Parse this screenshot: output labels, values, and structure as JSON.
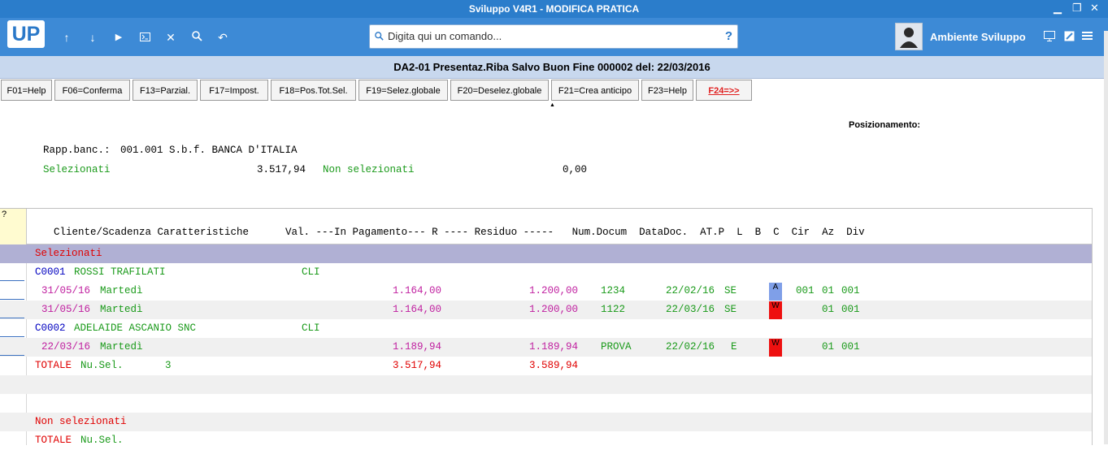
{
  "window": {
    "title": "Sviluppo V4R1 - MODIFICA PRATICA",
    "controls": {
      "minimize": "▁",
      "restore": "❐",
      "close": "✕"
    }
  },
  "toolbar": {
    "logo": "UP",
    "icons": [
      "arrow-up-icon",
      "arrow-down-icon",
      "play-icon",
      "terminal-icon",
      "close-icon",
      "search-icon",
      "undo-icon"
    ],
    "command_placeholder": "Digita qui un comando...",
    "help_glyph": "?",
    "environment": "Ambiente Sviluppo"
  },
  "header": {
    "title": "DA2-01 Presentaz.Riba Salvo Buon Fine 000002 del: 22/03/2016"
  },
  "fkeys": [
    {
      "label": "F01=Help"
    },
    {
      "label": "F06=Conferma"
    },
    {
      "label": "F13=Parzial."
    },
    {
      "label": "F17=Impost."
    },
    {
      "label": "F18=Pos.Tot.Sel."
    },
    {
      "label": "F19=Selez.globale"
    },
    {
      "label": "F20=Deselez.globale"
    },
    {
      "label": "F21=Crea anticipo"
    },
    {
      "label": "F23=Help"
    },
    {
      "label": "F24=>>"
    }
  ],
  "positioning_label": "Posizionamento:",
  "info": {
    "bank_label": "Rapp.banc.:",
    "bank_value": "001.001 S.b.f. BANCA D'ITALIA",
    "selected_label": "Selezionati",
    "selected_value": "3.517,94",
    "not_selected_label": "Non selezionati",
    "not_selected_value": "0,00"
  },
  "grid": {
    "corner": "?",
    "header": "Cliente/Scadenza Caratteristiche      Val. ---In Pagamento--- R ---- Residuo -----   Num.Docum  DataDoc.  AT.P  L  B  C  Cir  Az  Div",
    "section_selected": "Selezionati",
    "rows": [
      {
        "code": "C0001",
        "name": "ROSSI TRAFILATI",
        "val": "CLI"
      },
      {
        "date": "31/05/16",
        "day": "Martedì",
        "pag": "1.164,00",
        "res": "1.200,00",
        "doc": "1234",
        "datadoc": "22/02/16",
        "at": "SE",
        "b": "A",
        "cir": "001",
        "az": "01",
        "div": "001"
      },
      {
        "date": "31/05/16",
        "day": "Martedì",
        "pag": "1.164,00",
        "res": "1.200,00",
        "doc": "1122",
        "datadoc": "22/03/16",
        "at": "SE",
        "b": "W",
        "cir": "",
        "az": "01",
        "div": "001"
      },
      {
        "code": "C0002",
        "name": "ADELAIDE ASCANIO SNC",
        "val": "CLI"
      },
      {
        "date": "22/03/16",
        "day": "Martedì",
        "pag": "1.189,94",
        "res": "1.189,94",
        "doc": "PROVA",
        "datadoc": "22/02/16",
        "at": "E",
        "b": "W",
        "cir": "",
        "az": "01",
        "div": "001"
      }
    ],
    "total_sel": {
      "label": "TOTALE",
      "nu_label": "Nu.Sel.",
      "count": "3",
      "pag": "3.517,94",
      "res": "3.589,94"
    },
    "section_not_selected": "Non selezionati",
    "total_not_sel": {
      "label": "TOTALE",
      "nu_label": "Nu.Sel."
    }
  },
  "colors": {
    "titlebar": "#2b7dcb",
    "toolbar": "#3d8ad6",
    "green": "#1a9a1a",
    "magenta": "#c020a0",
    "red": "#e00000",
    "blue": "#0000c0",
    "badge_a": "#7f9fe8",
    "badge_w": "#ee1010"
  }
}
